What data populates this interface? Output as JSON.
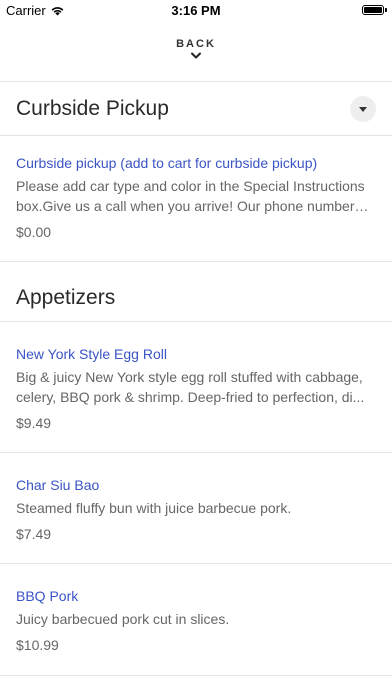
{
  "status_bar": {
    "carrier": "Carrier",
    "time": "3:16 PM"
  },
  "header": {
    "back_label": "BACK"
  },
  "sections": [
    {
      "title": "Curbside Pickup",
      "items": [
        {
          "name": "Curbside pickup (add to cart for curbside pickup)",
          "description": "Please add car type and color in the Special Instructions box.Give us a call when you arrive! Our phone number is...",
          "price": "$0.00"
        }
      ]
    },
    {
      "title": "Appetizers",
      "items": [
        {
          "name": "New York Style Egg Roll",
          "description": "Big & juicy New York style egg roll stuffed with cabbage, celery, BBQ pork & shrimp. Deep-fried to perfection, di...",
          "price": "$9.49"
        },
        {
          "name": "Char Siu Bao",
          "description": "Steamed fluffy bun with juice barbecue pork.",
          "price": "$7.49"
        },
        {
          "name": "BBQ Pork",
          "description": "Juicy barbecued pork cut in slices.",
          "price": "$10.99"
        }
      ]
    }
  ]
}
